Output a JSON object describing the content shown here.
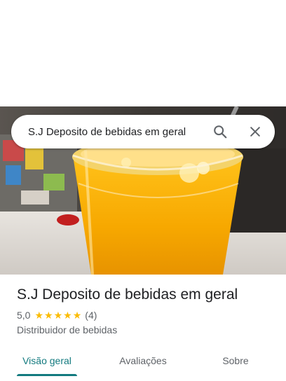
{
  "search": {
    "value": "S.J Deposito de bebidas em geral",
    "search_icon": "search-icon",
    "close_icon": "close-icon"
  },
  "place": {
    "title": "S.J Deposito de bebidas em geral",
    "rating": "5,0",
    "stars": 5,
    "review_count": "(4)",
    "category": "Distribuidor de bebidas"
  },
  "tabs": [
    {
      "label": "Visão geral",
      "active": true
    },
    {
      "label": "Avaliações",
      "active": false
    },
    {
      "label": "Sobre",
      "active": false
    }
  ],
  "colors": {
    "accent": "#137a7f",
    "star": "#fbbc04",
    "secondary_text": "#5f6368"
  }
}
